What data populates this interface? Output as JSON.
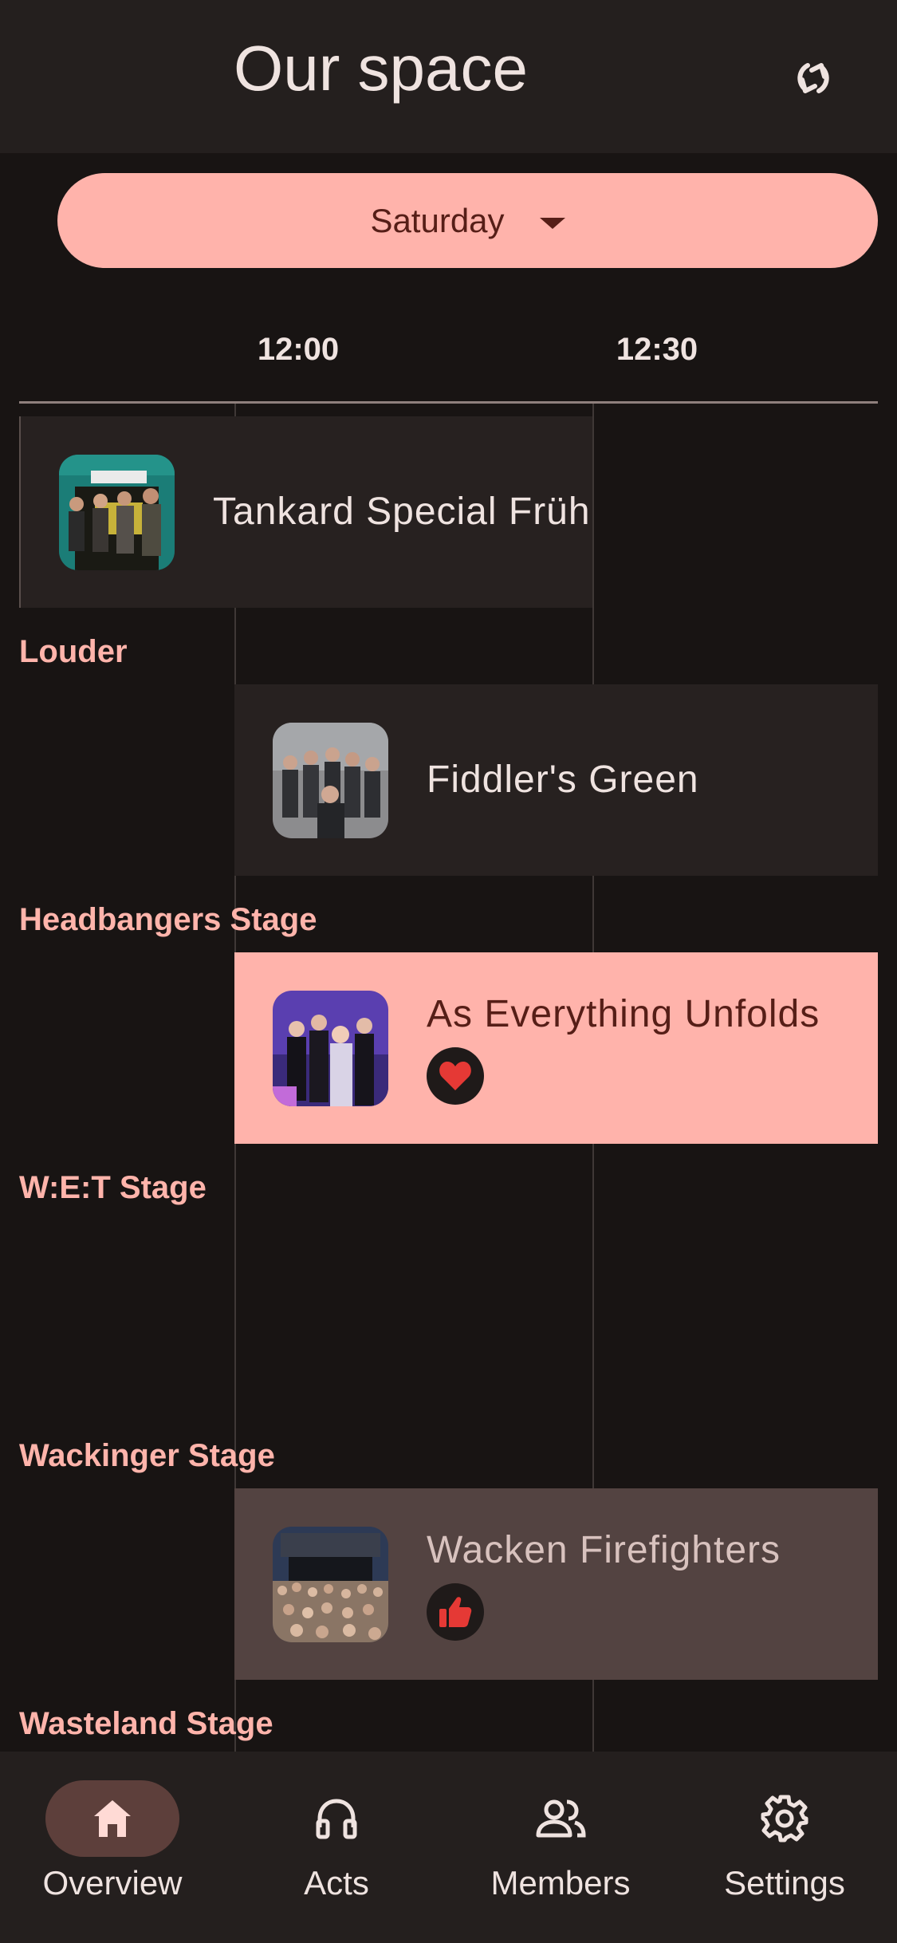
{
  "header": {
    "title": "Our space",
    "refresh_icon": "refresh-icon"
  },
  "day_selector": {
    "value": "Saturday",
    "icon": "caret-down-icon"
  },
  "timeline": {
    "times": [
      "12:00",
      "12:30"
    ]
  },
  "stages": [
    {
      "label": "Louder"
    },
    {
      "label": "Headbangers Stage"
    },
    {
      "label": "W:E:T Stage"
    },
    {
      "label": "Wackinger Stage"
    },
    {
      "label": "Wasteland Stage"
    }
  ],
  "acts": [
    {
      "name": "Tankard Special Früh",
      "stage": "Louder",
      "badge": null
    },
    {
      "name": "Fiddler's Green",
      "stage": "Headbangers Stage",
      "badge": null
    },
    {
      "name": "As Everything Unfolds",
      "stage": "W:E:T Stage",
      "badge": "heart-icon"
    },
    {
      "name": "Wacken Firefighters",
      "stage": "Wasteland Stage",
      "badge": "thumbs-up-icon"
    }
  ],
  "nav": [
    {
      "label": "Overview",
      "icon": "home-icon",
      "active": true
    },
    {
      "label": "Acts",
      "icon": "headphones-icon",
      "active": false
    },
    {
      "label": "Members",
      "icon": "group-icon",
      "active": false
    },
    {
      "label": "Settings",
      "icon": "gear-icon",
      "active": false
    }
  ],
  "colors": {
    "background": "#181413",
    "surface": "#241f1e",
    "accent": "#ffb3ab",
    "on_accent": "#561e17",
    "badge_red": "#e53935",
    "selected_act": "#ffb3ab",
    "dimmed_act": "#534341"
  }
}
